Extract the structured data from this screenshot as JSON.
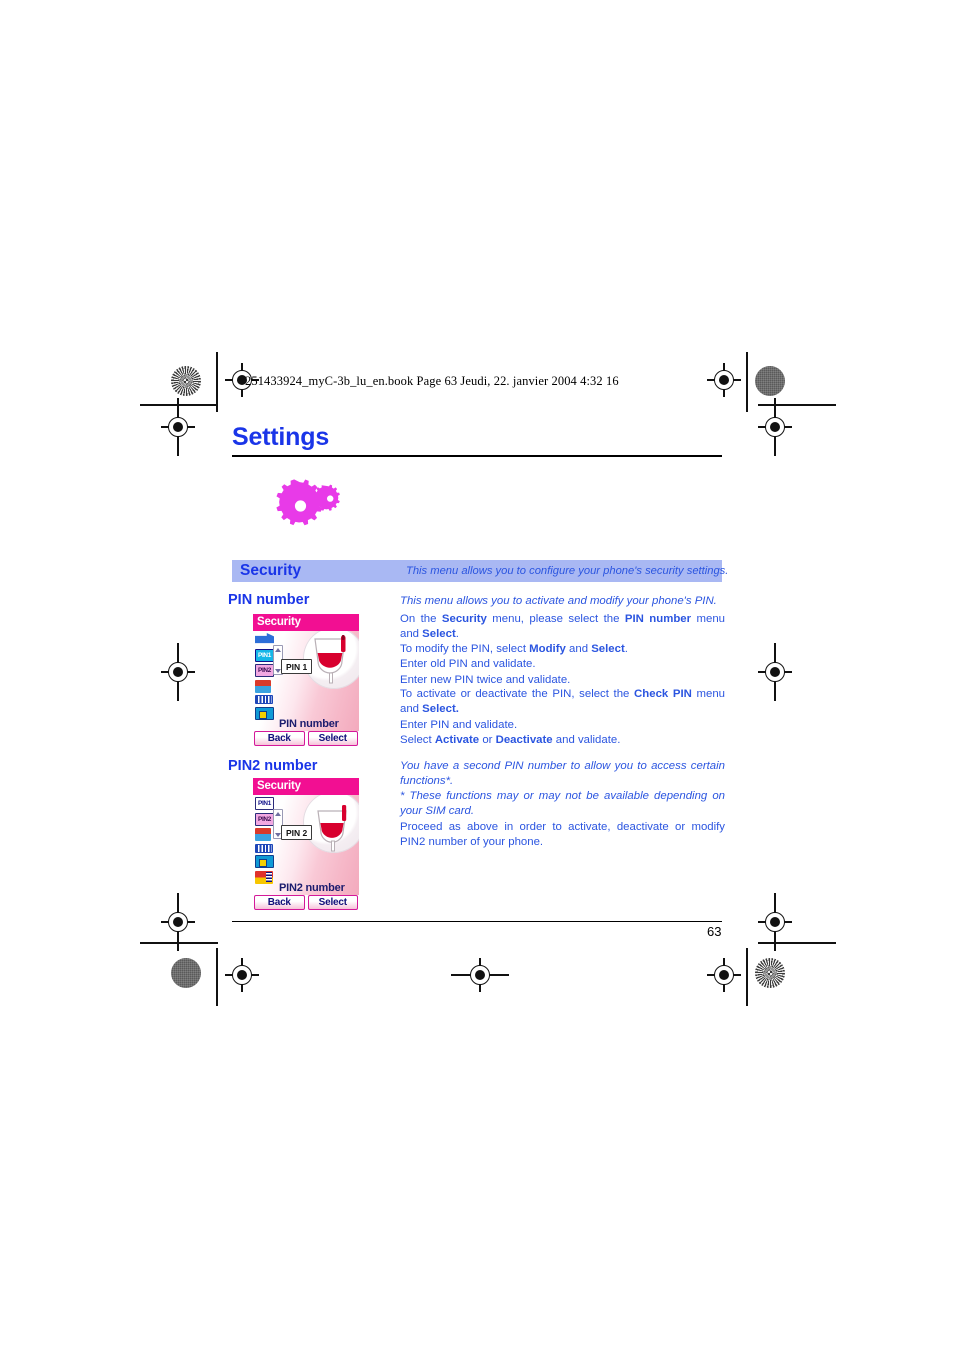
{
  "book_header": "251433924_myC-3b_lu_en.book  Page 63  Jeudi, 22. janvier 2004  4:32 16",
  "chapter": {
    "title": "Settings",
    "icon": "gears-icon"
  },
  "page_number": "63",
  "section": {
    "band_title": "Security",
    "band_description": "This menu allows you to configure your phone's security settings."
  },
  "pin": {
    "heading": "PIN number",
    "intro": "This menu allows you to activate and modify your phone's PIN.",
    "p1": {
      "seg1": "On the ",
      "b1": "Security",
      "seg2": " menu, please select the ",
      "b2": "PIN number",
      "seg3": " menu and ",
      "b3": "Select",
      "seg4": "."
    },
    "p2": {
      "seg1": "To modify the PIN, select ",
      "b1": "Modify",
      "seg2": " and ",
      "b2": "Select",
      "seg3": ".",
      "line2": "Enter old PIN and validate.",
      "line3": "Enter new PIN twice and validate."
    },
    "p3": {
      "seg1": "To activate or deactivate the PIN, select the ",
      "b1": "Check PIN",
      "seg2": " menu and ",
      "b2": "Select.",
      "line2": "Enter PIN and validate.",
      "line3_seg1": "Select ",
      "line3_b1": "Activate",
      "line3_seg2": " or ",
      "line3_b2": "Deactivate",
      "line3_seg3": " and validate."
    }
  },
  "pin2": {
    "heading": "PIN2 number",
    "p1": "You have a second PIN number to allow you to access certain functions*.",
    "p2": "* These functions may or may not be available depending on your SIM card.",
    "p3": "Proceed as above in order to activate, deactivate or modify PIN2 number of your phone."
  },
  "phone_screen_1": {
    "title": "Security",
    "callout": "PIN 1",
    "label": "PIN number",
    "softkey_left": "Back",
    "softkey_right": "Select",
    "icons": [
      "sim-card-icon",
      "pin1-icon",
      "pin2-icon",
      "call-barring-icon",
      "network-icon",
      "folder-icon"
    ]
  },
  "phone_screen_2": {
    "title": "Security",
    "callout": "PIN 2",
    "label": "PIN2 number",
    "softkey_left": "Back",
    "softkey_right": "Select",
    "icons": [
      "pin1-icon",
      "pin2-icon",
      "call-barring-icon",
      "network-icon",
      "folder-icon",
      "list-icon"
    ]
  },
  "colors": {
    "heading_blue": "#1a35e8",
    "body_blue": "#2b55e0",
    "band_bg": "#a9b8f3",
    "gear_magenta": "#e83ae8",
    "phone_magenta": "#f20f92"
  }
}
